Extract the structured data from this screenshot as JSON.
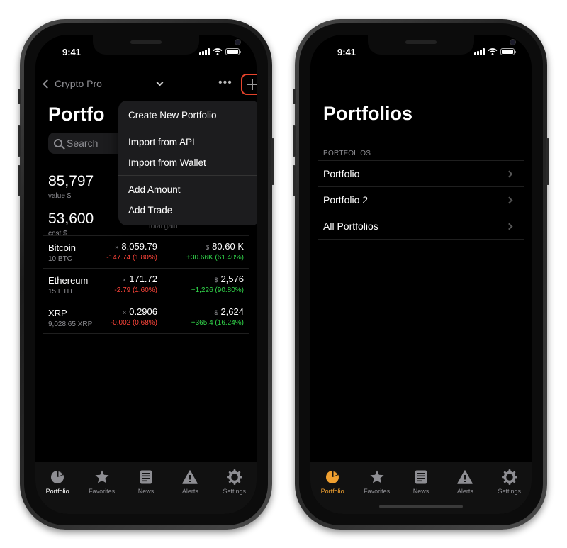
{
  "status_bar": {
    "time": "9:41"
  },
  "left_screen": {
    "nav": {
      "back_label": "Crypto Pro"
    },
    "title": "Portfo",
    "search": {
      "placeholder": "Search"
    },
    "summary": {
      "value": "85,797",
      "value_label": "value $",
      "cost": "53,600",
      "cost_label": "cost $",
      "gain_label": "total gain"
    },
    "holdings": [
      {
        "name": "Bitcoin",
        "qty": "10 BTC",
        "price_sym": "×",
        "price": "8,059.79",
        "change": "-147.74 (1.80%)",
        "value_sym": "$",
        "value": "80.60 K",
        "value_change": "+30.66K (61.40%)"
      },
      {
        "name": "Ethereum",
        "qty": "15 ETH",
        "price_sym": "×",
        "price": "171.72",
        "change": "-2.79 (1.60%)",
        "value_sym": "$",
        "value": "2,576",
        "value_change": "+1,226 (90.80%)"
      },
      {
        "name": "XRP",
        "qty": "9,028.65 XRP",
        "price_sym": "×",
        "price": "0.2906",
        "change": "-0.002 (0.68%)",
        "value_sym": "$",
        "value": "2,624",
        "value_change": "+365.4 (16.24%)"
      }
    ],
    "menu": {
      "create_new_portfolio": "Create New Portfolio",
      "import_from_api": "Import from API",
      "import_from_wallet": "Import from Wallet",
      "add_amount": "Add Amount",
      "add_trade": "Add Trade"
    }
  },
  "right_screen": {
    "title": "Portfolios",
    "section_header": "PORTFOLIOS",
    "items": [
      "Portfolio",
      "Portfolio 2",
      "All Portfolios"
    ]
  },
  "tabs": {
    "portfolio": "Portfolio",
    "favorites": "Favorites",
    "news": "News",
    "alerts": "Alerts",
    "settings": "Settings"
  },
  "colors": {
    "loss": "#ff453a",
    "gain": "#32d74b",
    "highlight_ring": "#e8442c",
    "active_tab_orange": "#f0a030"
  }
}
